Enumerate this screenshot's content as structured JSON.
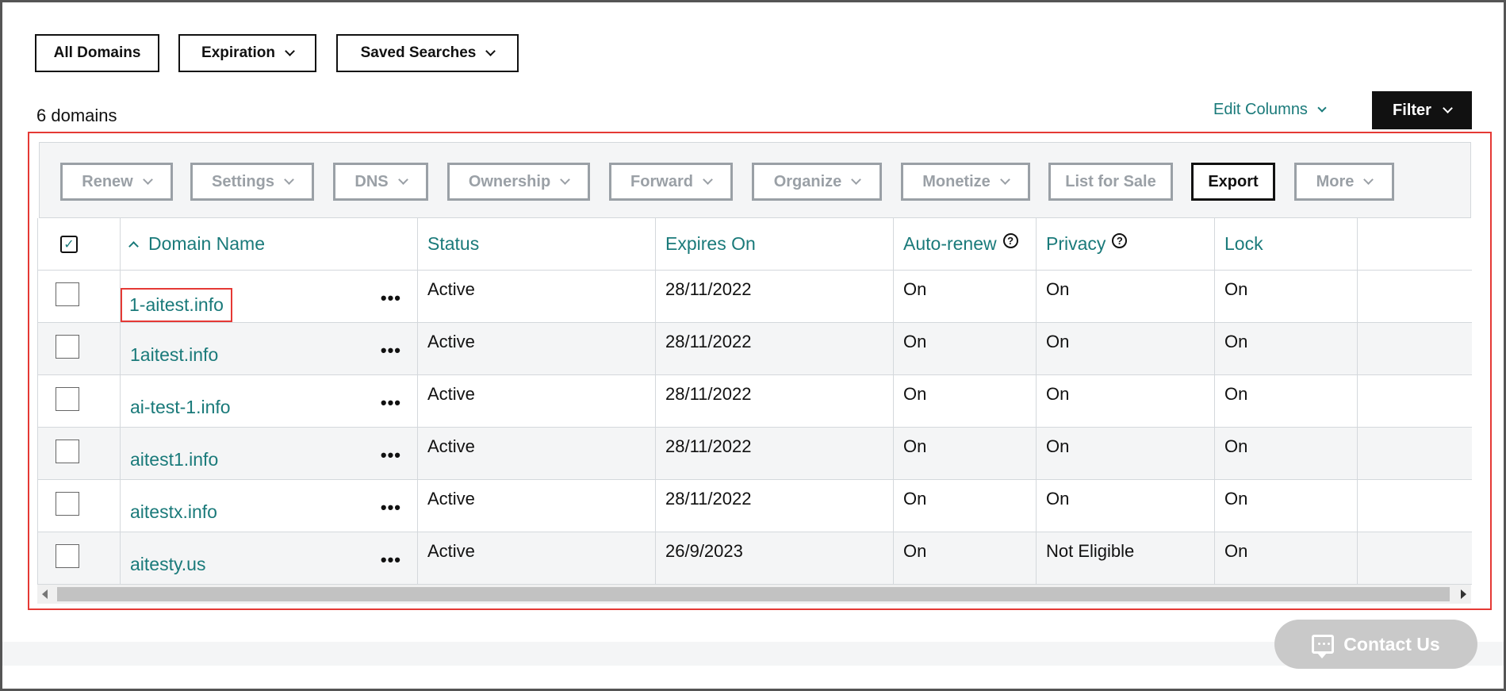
{
  "top_filters": [
    {
      "label": "All Domains"
    },
    {
      "label": "Expiration"
    },
    {
      "label": "Saved Searches"
    }
  ],
  "domain_count": "6 domains",
  "edit_columns": "Edit Columns",
  "filter_button": "Filter",
  "toolbar": [
    {
      "label": "Renew"
    },
    {
      "label": "Settings"
    },
    {
      "label": "DNS"
    },
    {
      "label": "Ownership"
    },
    {
      "label": "Forward"
    },
    {
      "label": "Organize"
    },
    {
      "label": "Monetize"
    },
    {
      "label": "List for Sale"
    },
    {
      "label": "Export"
    },
    {
      "label": "More"
    }
  ],
  "table": {
    "headers": {
      "domain_name": "Domain Name",
      "status": "Status",
      "expires_on": "Expires On",
      "auto_renew": "Auto-renew",
      "privacy": "Privacy",
      "lock": "Lock"
    },
    "info_glyph": "?",
    "more_glyph": "•••",
    "rows": [
      {
        "domain": "1-aitest.info",
        "status": "Active",
        "expires": "28/11/2022",
        "auto_renew": "On",
        "privacy": "On",
        "lock": "On"
      },
      {
        "domain": "1aitest.info",
        "status": "Active",
        "expires": "28/11/2022",
        "auto_renew": "On",
        "privacy": "On",
        "lock": "On"
      },
      {
        "domain": "ai-test-1.info",
        "status": "Active",
        "expires": "28/11/2022",
        "auto_renew": "On",
        "privacy": "On",
        "lock": "On"
      },
      {
        "domain": "aitest1.info",
        "status": "Active",
        "expires": "28/11/2022",
        "auto_renew": "On",
        "privacy": "On",
        "lock": "On"
      },
      {
        "domain": "aitestx.info",
        "status": "Active",
        "expires": "28/11/2022",
        "auto_renew": "On",
        "privacy": "On",
        "lock": "On"
      },
      {
        "domain": "aitesty.us",
        "status": "Active",
        "expires": "26/9/2023",
        "auto_renew": "On",
        "privacy": "Not Eligible",
        "lock": "On"
      }
    ]
  },
  "contact_us": "Contact Us",
  "colors": {
    "link_teal": "#1a7a7a",
    "highlight_red": "#e53935",
    "disabled_gray": "#9aa0a6"
  }
}
